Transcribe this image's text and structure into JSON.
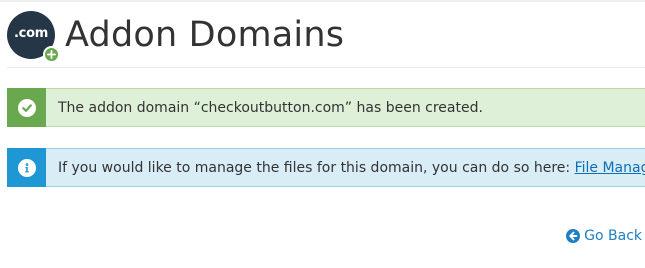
{
  "header": {
    "logo_text": ".com",
    "title": "Addon Domains"
  },
  "alerts": {
    "success": {
      "icon": "check-circle-icon",
      "message": "The addon domain “checkoutbutton.com” has been created."
    },
    "info": {
      "icon": "info-circle-icon",
      "message_prefix": "If you would like to manage the files for this domain, you can do so here: ",
      "link_label": "File Manager"
    }
  },
  "footer": {
    "go_back_icon": "arrow-circle-left-icon",
    "go_back_label": "Go Back"
  },
  "colors": {
    "logo_background": "#253746",
    "logo_badge": "#6aa84f",
    "success_background": "#dff0d8",
    "success_accent": "#6aa84f",
    "info_background": "#d9edf7",
    "info_accent": "#1e97d4",
    "link": "#1e7fc1"
  }
}
